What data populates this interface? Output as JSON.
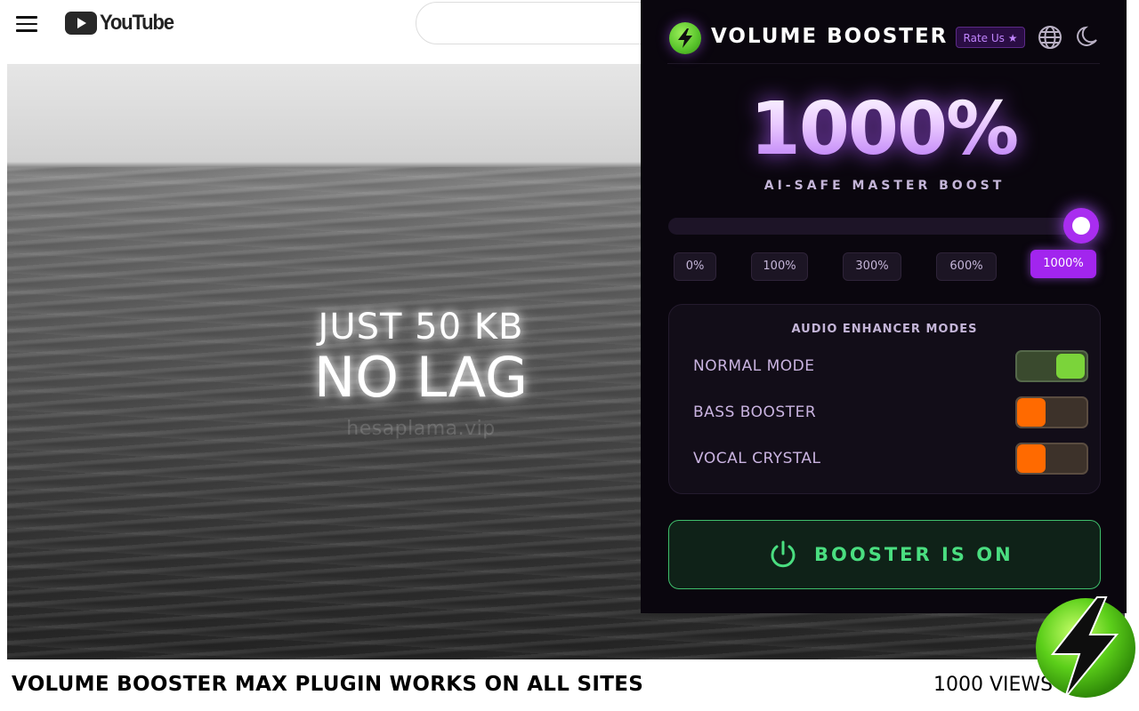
{
  "youtube": {
    "logo_text": "YouTube",
    "search_placeholder": ""
  },
  "video": {
    "overlay_line1": "JUST 50 KB",
    "overlay_line2": "NO LAG",
    "watermark": "hesaplama.vip"
  },
  "caption": {
    "title": "VOLUME BOOSTER MAX PLUGIN WORKS ON ALL SITES",
    "views": "1000 VIEWS"
  },
  "popup": {
    "title": "VOLUME BOOSTER",
    "rate_label": "Rate Us ★",
    "icons": [
      "lightning-bolt-icon",
      "globe-icon",
      "moon-icon",
      "power-icon"
    ],
    "boost_value": "1000%",
    "boost_subtitle": "AI-SAFE MASTER BOOST",
    "slider_level_percent": 1000,
    "slider_max_percent": 1000,
    "presets": [
      "0%",
      "100%",
      "300%",
      "600%",
      "1000%"
    ],
    "active_preset": "1000%",
    "modes_title": "AUDIO ENHANCER MODES",
    "modes": [
      {
        "label": "NORMAL MODE",
        "on": true
      },
      {
        "label": "BASS BOOSTER",
        "on": false
      },
      {
        "label": "VOCAL CRYSTAL",
        "on": false
      }
    ],
    "power_label": "BOOSTER IS ON"
  },
  "colors": {
    "popup_bg": "#0a060e",
    "accent_purple": "#a855f7",
    "on_green": "#4ade80",
    "toggle_off_orange": "#ff6a00"
  }
}
